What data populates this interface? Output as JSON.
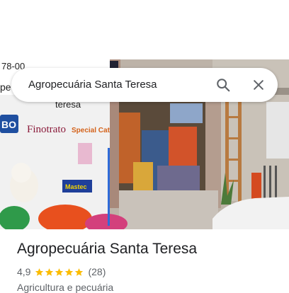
{
  "search": {
    "query": "Agropecuária Santa Teresa",
    "search_icon": "search-icon",
    "close_icon": "close-icon"
  },
  "photo": {
    "description_icon": "storefront-photo",
    "sign_text_left": "78-00",
    "sign_text_left_2": "pe",
    "sign_text_left_3": "teresa",
    "banner_logo_1": "BO",
    "banner_logo_2": "Finotrato",
    "banner_logo_3": "Special Cat",
    "banner_logo_4": "Mastec"
  },
  "place": {
    "name": "Agropecuária Santa Teresa",
    "rating": "4,9",
    "stars": 5,
    "review_count": "(28)",
    "category": "Agricultura e pecuária"
  },
  "colors": {
    "star": "#fbbc04",
    "text_primary": "#202124",
    "text_secondary": "#5f6368"
  }
}
